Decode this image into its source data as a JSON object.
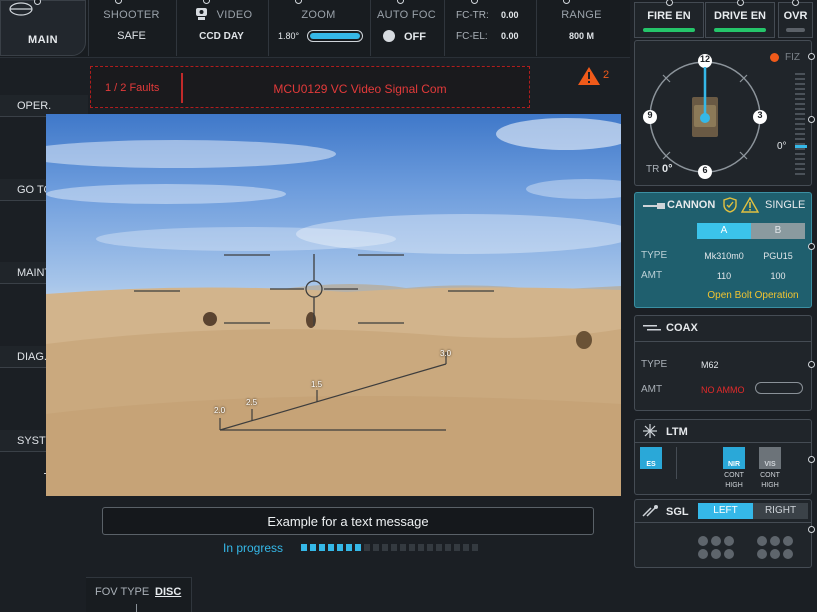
{
  "topbar": {
    "main_label": "MAIN",
    "shooter": {
      "title": "SHOOTER",
      "value": "SAFE"
    },
    "video": {
      "title": "VIDEO",
      "value": "CCD DAY"
    },
    "zoom": {
      "title": "ZOOM",
      "value": "1.80°"
    },
    "autofoc": {
      "title": "AUTO FOC",
      "value": "OFF"
    },
    "fc": {
      "tr_label": "FC-TR:",
      "tr_value": "0.00",
      "el_label": "FC-EL:",
      "el_value": "0.00"
    },
    "range": {
      "title": "RANGE",
      "value": "800 M"
    }
  },
  "top_buttons": {
    "fire_en": "FIRE EN",
    "drive_en": "DRIVE EN",
    "ovr": "OVR"
  },
  "fault": {
    "count": "1 / 2 Faults",
    "message": "MCU0129  VC Video Signal Com",
    "warning_count": "2"
  },
  "side_menu": [
    "OPER.",
    "GO TO",
    "MAINT.",
    "DIAG.",
    "SYSTEM"
  ],
  "video_overlay": {
    "ticks": [
      "2.0",
      "2.5",
      "1.5",
      "3.0"
    ]
  },
  "message": {
    "text": "Example for a text message",
    "progress_label": "In progress",
    "progress_filled": 7,
    "progress_total": 20
  },
  "fov": {
    "label": "FOV TYPE",
    "value": "DISC"
  },
  "compass": {
    "n": "12",
    "e": "3",
    "s": "6",
    "w": "9",
    "tr_label": "TR",
    "tr_value": "0°",
    "el_value": "0°",
    "fiz": "FIZ"
  },
  "cannon": {
    "title": "CANNON",
    "mode": "SINGLE",
    "tab_a": "A",
    "tab_b": "B",
    "type_label": "TYPE",
    "type_a": "Mk310m0",
    "type_b": "PGU15",
    "amt_label": "AMT",
    "amt_a": "110",
    "amt_b": "100",
    "status": "Open Bolt Operation"
  },
  "coax": {
    "title": "COAX",
    "type_label": "TYPE",
    "type_value": "M62",
    "amt_label": "AMT",
    "amt_value": "NO AMMO"
  },
  "ltm": {
    "title": "LTM",
    "es": "ES",
    "nir": "NIR",
    "vis": "VIS",
    "nir_sub1": "CONT",
    "nir_sub2": "HIGH",
    "vis_sub1": "CONT",
    "vis_sub2": "HIGH"
  },
  "sgl": {
    "title": "SGL",
    "left": "LEFT",
    "right": "RIGHT"
  },
  "colors": {
    "accent": "#35b8e8",
    "fault": "#e23a3a",
    "ok": "#25c56a",
    "cannon_bg": "#1f5f6e"
  }
}
